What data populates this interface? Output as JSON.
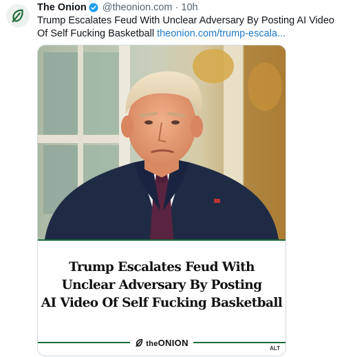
{
  "post": {
    "author_name": "The Onion",
    "handle": "@theonion.com",
    "separator": "·",
    "time": "10h",
    "text": "Trump Escalates Feud With Unclear Adversary By Posting AI Video Of Self Fucking Basketball ",
    "link": "theonion.com/trump-escala..."
  },
  "card": {
    "headline_line1": "Trump Escalates Feud With",
    "headline_line2": "Unclear Adversary By Posting",
    "headline_line3": "AI Video Of Self Fucking Basketball",
    "logo_the": "the",
    "logo_onion": "ONION",
    "alt_badge": "ALT"
  },
  "colors": {
    "brand_green": "#1c6b3a",
    "link_blue": "#1d78c8",
    "verified_blue": "#1d9bf0"
  },
  "icons": {
    "avatar": "onion-leaf-logo",
    "verified": "verified-badge-icon"
  }
}
